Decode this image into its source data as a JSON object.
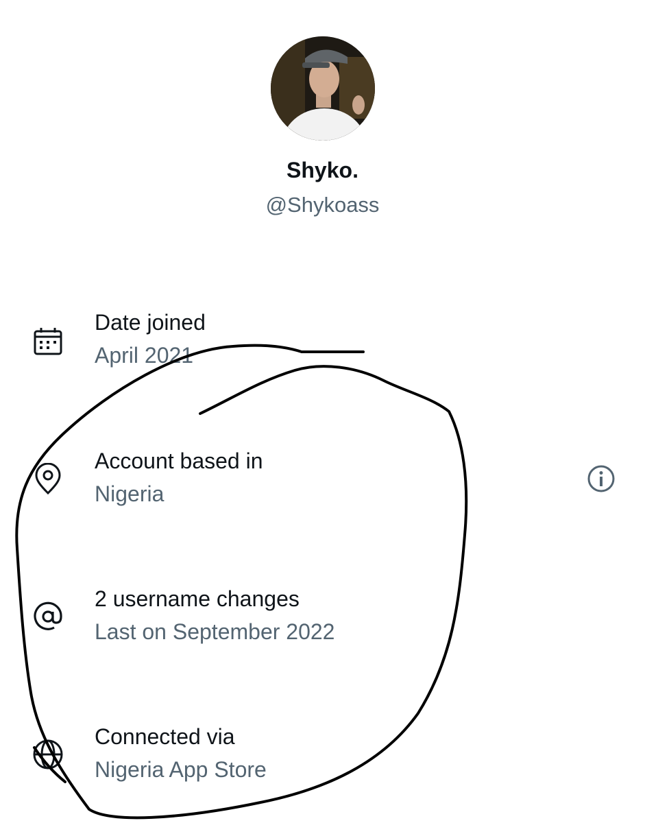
{
  "profile": {
    "display_name": "Shyko.",
    "handle": "@Shykoass"
  },
  "about": {
    "rows": [
      {
        "icon": "calendar-icon",
        "title": "Date joined",
        "value": "April 2021"
      },
      {
        "icon": "location-pin-icon",
        "title": "Account based in",
        "value": "Nigeria"
      },
      {
        "icon": "at-sign-icon",
        "title": "2 username changes",
        "value": "Last on September 2022"
      },
      {
        "icon": "globe-icon",
        "title": "Connected via",
        "value": "Nigeria App Store"
      }
    ],
    "info_icon": "info-circle-icon"
  },
  "colors": {
    "primary_text": "#0f1419",
    "secondary_text": "#536471",
    "annotation_ink": "#000000"
  }
}
